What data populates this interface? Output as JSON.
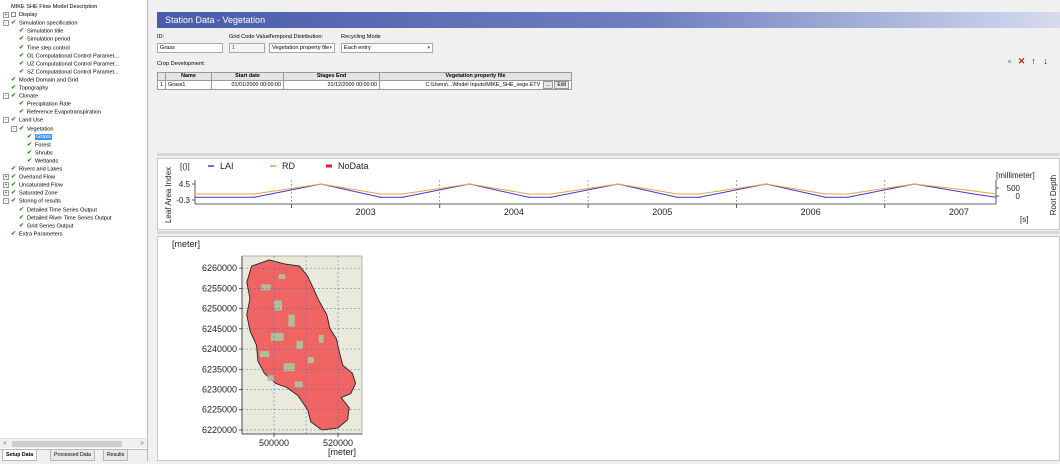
{
  "tree": {
    "items": [
      {
        "label": "MIKE SHE Flow Model Description",
        "level": 0,
        "exp": "",
        "icon": "none",
        "selected": false
      },
      {
        "label": "Display",
        "level": 0,
        "exp": "+",
        "icon": "box",
        "selected": false
      },
      {
        "label": "Simulation specification",
        "level": 0,
        "exp": "-",
        "icon": "check",
        "selected": false
      },
      {
        "label": "Simulation title",
        "level": 2,
        "exp": "",
        "icon": "check",
        "selected": false
      },
      {
        "label": "Simulation period",
        "level": 2,
        "exp": "",
        "icon": "check",
        "selected": false
      },
      {
        "label": "Time step control",
        "level": 2,
        "exp": "",
        "icon": "check",
        "selected": false
      },
      {
        "label": "OL Computational Control Paramet...",
        "level": 2,
        "exp": "",
        "icon": "check",
        "selected": false
      },
      {
        "label": "UZ Computational Control Paramet...",
        "level": 2,
        "exp": "",
        "icon": "check",
        "selected": false
      },
      {
        "label": "SZ Computational Control Paramet...",
        "level": 2,
        "exp": "",
        "icon": "check",
        "selected": false
      },
      {
        "label": "Model Domain and Grid",
        "level": 1,
        "exp": "",
        "icon": "check",
        "selected": false
      },
      {
        "label": "Topography",
        "level": 1,
        "exp": "",
        "icon": "check",
        "selected": false
      },
      {
        "label": "Climate",
        "level": 0,
        "exp": "-",
        "icon": "check",
        "selected": false
      },
      {
        "label": "Precipitation Rate",
        "level": 2,
        "exp": "",
        "icon": "check",
        "selected": false
      },
      {
        "label": "Reference Evapotranspiration",
        "level": 2,
        "exp": "",
        "icon": "check",
        "selected": false
      },
      {
        "label": "Land Use",
        "level": 0,
        "exp": "-",
        "icon": "check",
        "selected": false
      },
      {
        "label": "Vegetation",
        "level": 1,
        "exp": "-",
        "icon": "check",
        "selected": false
      },
      {
        "label": "Grass",
        "level": 3,
        "exp": "",
        "icon": "check",
        "selected": true
      },
      {
        "label": "Forest",
        "level": 3,
        "exp": "",
        "icon": "check",
        "selected": false
      },
      {
        "label": "Shrubs",
        "level": 3,
        "exp": "",
        "icon": "check",
        "selected": false
      },
      {
        "label": "Wetlands",
        "level": 3,
        "exp": "",
        "icon": "check",
        "selected": false
      },
      {
        "label": "Rivers and Lakes",
        "level": 1,
        "exp": "",
        "icon": "check",
        "selected": false
      },
      {
        "label": "Overland Flow",
        "level": 0,
        "exp": "+",
        "icon": "check",
        "selected": false
      },
      {
        "label": "Unsaturated Flow",
        "level": 0,
        "exp": "+",
        "icon": "check",
        "selected": false
      },
      {
        "label": "Saturated Zone",
        "level": 0,
        "exp": "+",
        "icon": "check",
        "selected": false
      },
      {
        "label": "Storing of results",
        "level": 0,
        "exp": "-",
        "icon": "check",
        "selected": false
      },
      {
        "label": "Detailed Time Series Output",
        "level": 2,
        "exp": "",
        "icon": "check",
        "selected": false
      },
      {
        "label": "Detailed River Time Series Output",
        "level": 2,
        "exp": "",
        "icon": "check",
        "selected": false
      },
      {
        "label": "Grid Series Output",
        "level": 2,
        "exp": "",
        "icon": "check",
        "selected": false
      },
      {
        "label": "Extra Parameters",
        "level": 1,
        "exp": "",
        "icon": "check",
        "selected": false
      }
    ],
    "scroll_left": "<",
    "scroll_right": ">"
  },
  "bottom_tabs": [
    "Setup Data",
    "Processed Data",
    "Results"
  ],
  "panel": {
    "title": "Station Data - Vegetation",
    "id_label": "ID:",
    "id_value": "Grass",
    "grid_code_label": "Grid Code Value:",
    "grid_code_value": "1",
    "temporal_label": "Temporal Distribution:",
    "temporal_value": "Vegetation property file",
    "recycling_label": "Recycling Mode",
    "recycling_value": "Each entry",
    "crop_label": "Crop Development:"
  },
  "crop_table": {
    "headers": [
      "",
      "Name",
      "Start date",
      "Stages End",
      "Vegetation property file"
    ],
    "rows": [
      {
        "num": "1",
        "name": "Grass1",
        "start": "01/01/2000 00:00:00",
        "end": "31/12/2000 00:00:00",
        "file": "C:\\Users\\...\\Model Inputs\\MIKE_SHE_vege.ETV",
        "browse": "...",
        "edit": "Edit"
      }
    ]
  },
  "table_tools": [
    {
      "name": "new-row-icon",
      "glyph": "▫"
    },
    {
      "name": "delete-row-icon",
      "glyph": "✕"
    },
    {
      "name": "move-up-icon",
      "glyph": "↑"
    },
    {
      "name": "move-down-icon",
      "glyph": "↓"
    }
  ],
  "colors": {
    "lai": "#3a3ad0",
    "rd": "#f0a040",
    "nodata": "#e02020",
    "title_bar": "#4a5ca8",
    "map_fill": "#f06464",
    "map_green": "#a8c8a0"
  },
  "chart_data": [
    {
      "type": "line",
      "legend": [
        "LAI",
        "RD",
        "NoData"
      ],
      "ylabel_left": "Leaf Area Index",
      "yunit_left": "[()]",
      "ylabel_right": "Root Depth",
      "yunit_right": "[millimeter]",
      "xunit": "[s]",
      "x_tick_labels": [
        "2003",
        "2004",
        "2005",
        "2006",
        "2007"
      ],
      "y_left_ticks": [
        "4.5",
        "-0.3"
      ],
      "y_right_ticks": [
        "500",
        "0"
      ],
      "x_range": [
        2002.35,
        2007.75
      ],
      "y_left_range": [
        -0.3,
        4.5
      ],
      "y_right_range": [
        0,
        500
      ],
      "series": [
        {
          "name": "LAI",
          "x": [
            2002.35,
            2002.75,
            2003.2,
            2003.6,
            2003.75,
            2004.2,
            2004.6,
            2004.75,
            2005.2,
            2005.6,
            2005.75,
            2006.2,
            2006.6,
            2006.75,
            2007.2,
            2007.6,
            2007.75
          ],
          "y": [
            0.5,
            0.5,
            4.5,
            0.5,
            0.5,
            4.5,
            0.5,
            0.5,
            4.5,
            0.5,
            0.5,
            4.5,
            0.5,
            0.5,
            4.5,
            1.5,
            0.5
          ]
        },
        {
          "name": "RD",
          "x": [
            2002.35,
            2002.75,
            2003.2,
            2003.6,
            2003.75,
            2004.2,
            2004.6,
            2004.75,
            2005.2,
            2005.6,
            2005.75,
            2006.2,
            2006.6,
            2006.75,
            2007.2,
            2007.6,
            2007.75
          ],
          "y": [
            1.5,
            1.5,
            4.5,
            1.5,
            1.5,
            4.5,
            1.5,
            1.5,
            4.5,
            1.5,
            1.5,
            4.5,
            1.5,
            1.5,
            4.5,
            2.4,
            1.5
          ]
        }
      ]
    },
    {
      "type": "heatmap",
      "ylabel": "[meter]",
      "xlabel": "[meter]",
      "y_tick_labels": [
        "6260000",
        "6255000",
        "6250000",
        "6245000",
        "6240000",
        "6235000",
        "6230000",
        "6225000",
        "6220000"
      ],
      "x_tick_labels": [
        "500000",
        "520000"
      ],
      "y_range": [
        6219000,
        6263000
      ],
      "x_range": [
        490000,
        527500
      ]
    }
  ]
}
